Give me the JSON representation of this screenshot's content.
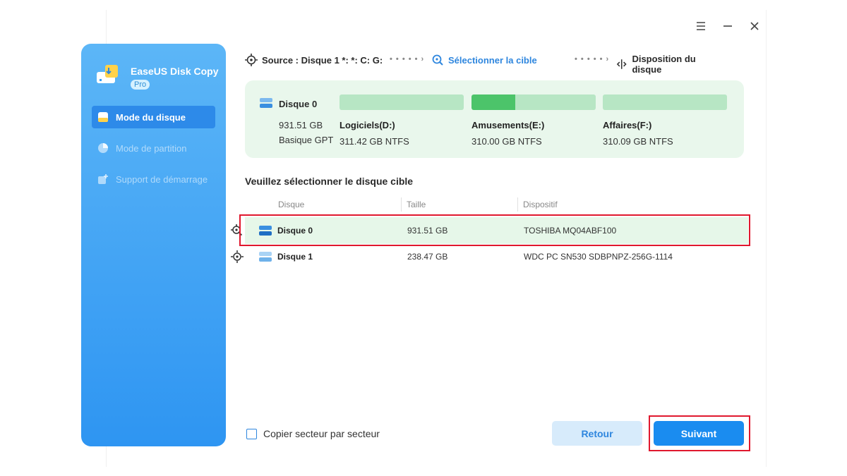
{
  "window": {
    "controls": {
      "menu_icon": "hamburger-icon",
      "minimize_icon": "minimize-icon",
      "close_icon": "close-icon"
    }
  },
  "sidebar": {
    "app_name": "EaseUS Disk Copy",
    "badge": "Pro",
    "items": [
      {
        "label": "Mode du disque",
        "icon": "disk-mode-icon",
        "active": true
      },
      {
        "label": "Mode de partition",
        "icon": "pie-chart-icon",
        "active": false
      },
      {
        "label": "Support de démarrage",
        "icon": "boot-media-icon",
        "active": false
      }
    ]
  },
  "steps": {
    "source": "Source : Disque 1 *: *: C: G:",
    "target": "Sélectionner la cible",
    "layout": "Disposition du disque"
  },
  "source_disk": {
    "name": "Disque 0",
    "size": "931.51 GB",
    "type": "Basique GPT",
    "partitions": [
      {
        "name": "Logiciels(D:)",
        "info": "311.42 GB NTFS",
        "used_fraction": 0.0
      },
      {
        "name": "Amusements(E:)",
        "info": "310.00 GB NTFS",
        "used_fraction": 0.35
      },
      {
        "name": "Affaires(F:)",
        "info": "310.09 GB NTFS",
        "used_fraction": 0.0
      }
    ]
  },
  "section_title": "Veuillez sélectionner le disque cible",
  "table": {
    "headers": {
      "disk": "Disque",
      "size": "Taille",
      "device": "Dispositif"
    },
    "rows": [
      {
        "disk": "Disque 0",
        "size": "931.51 GB",
        "device": "TOSHIBA MQ04ABF100",
        "selected": true
      },
      {
        "disk": "Disque 1",
        "size": "238.47 GB",
        "device": "WDC PC SN530 SDBPNPZ-256G-1114",
        "selected": false
      }
    ]
  },
  "options": {
    "sector_copy_label": "Copier secteur par secteur",
    "sector_copy_checked": false
  },
  "buttons": {
    "back": "Retour",
    "next": "Suivant"
  },
  "colors": {
    "accent": "#1a8cf0",
    "sidebar": "#3a9ff4",
    "selection_bg": "#e6f7e9",
    "highlight_box": "#e0182e",
    "partition_used": "#4cc46a"
  }
}
